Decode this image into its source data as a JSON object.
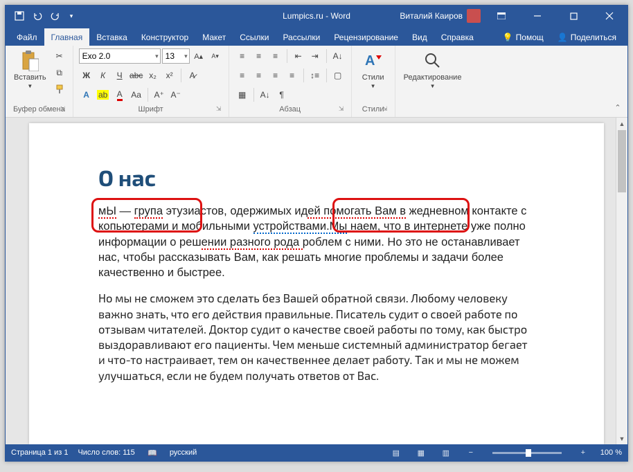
{
  "titlebar": {
    "title": "Lumpics.ru - Word",
    "user": "Виталий Каиров"
  },
  "tabs": {
    "file": "Файл",
    "home": "Главная",
    "insert": "Вставка",
    "design": "Конструктор",
    "layout": "Макет",
    "references": "Ссылки",
    "mailings": "Рассылки",
    "review": "Рецензирование",
    "view": "Вид",
    "help_tab": "Справка",
    "assist": "Помощ",
    "share": "Поделиться"
  },
  "ribbon": {
    "clipboard": {
      "label": "Буфер обмена",
      "paste": "Вставить"
    },
    "font": {
      "label": "Шрифт",
      "name": "Exo 2.0",
      "size": "13"
    },
    "paragraph": {
      "label": "Абзац"
    },
    "styles": {
      "label": "Стили",
      "btn": "Стили"
    },
    "editing": {
      "label": "Редактирование"
    }
  },
  "document": {
    "heading": "О нас",
    "p1a": "мЫ",
    "p1b": " — ",
    "p1c": "група",
    "p1d": " э",
    "p1e": "тузиастов, одержимых ид",
    "p1f": "ей помогать Вам в",
    "p1g": " ",
    "p1h": "жедневном контакте с ко",
    "p1i": "пьютерами и мобильным",
    "p1j": "и ",
    "p1k": "устройствами.Мы",
    "p1l": " ",
    "p1m": "наем, что в интернете уже полно информации о реш",
    "p1n": "ении разного рода ",
    "p1o": "роблем с ними. Но это не останавливает нас, чтобы рассказывать Вам, как решать многие проблемы и задачи более качественно и быстрее.",
    "p2": "Но мы не сможем это сделать без Вашей обратной связи. Любому человеку важно знать, что его действия правильные. Писатель судит о своей работе по отзывам читателей. Доктор судит о качестве своей работы по тому, как быстро выздоравливают его пациенты. Чем меньше системный администратор бегает и что-то настраивает, тем он качественнее делает работу. Так и мы не можем улучшаться, если не будем получать ответов от Вас."
  },
  "statusbar": {
    "page": "Страница 1 из 1",
    "words": "Число слов: 115",
    "lang": "русский",
    "zoom": "100 %"
  }
}
